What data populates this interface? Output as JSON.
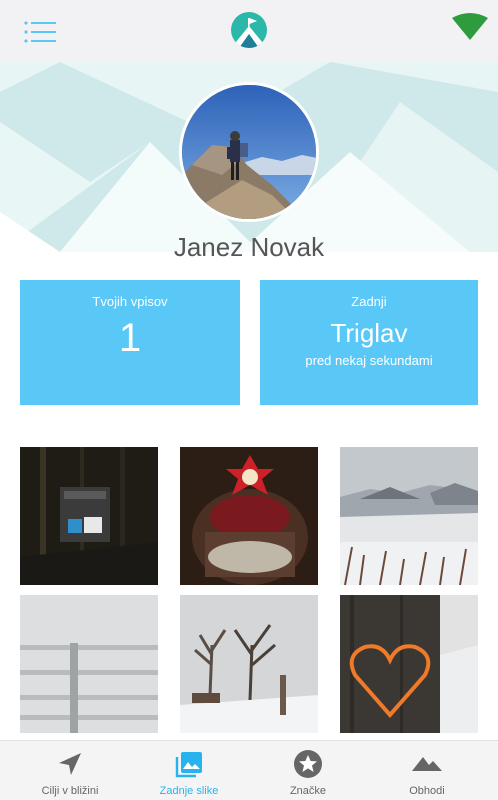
{
  "profile": {
    "name": "Janez Novak"
  },
  "stats": {
    "entries_caption": "Tvojih vpisov",
    "entries_count": "1",
    "last_caption": "Zadnji",
    "last_name": "Triglav",
    "last_time": "pred nekaj sekundami"
  },
  "bottom_nav": {
    "items": [
      {
        "label": "Cilji v bližini",
        "icon": "navigation-arrow-icon"
      },
      {
        "label": "Zadnje slike",
        "icon": "photos-icon",
        "active": true
      },
      {
        "label": "Značke",
        "icon": "star-badge-icon"
      },
      {
        "label": "Obhodi",
        "icon": "mountains-icon"
      }
    ]
  },
  "colors": {
    "accent": "#5ac8f7",
    "active_nav": "#29b3ee",
    "logo_teal": "#2bb7a9",
    "signal_green": "#2e9c3e"
  }
}
